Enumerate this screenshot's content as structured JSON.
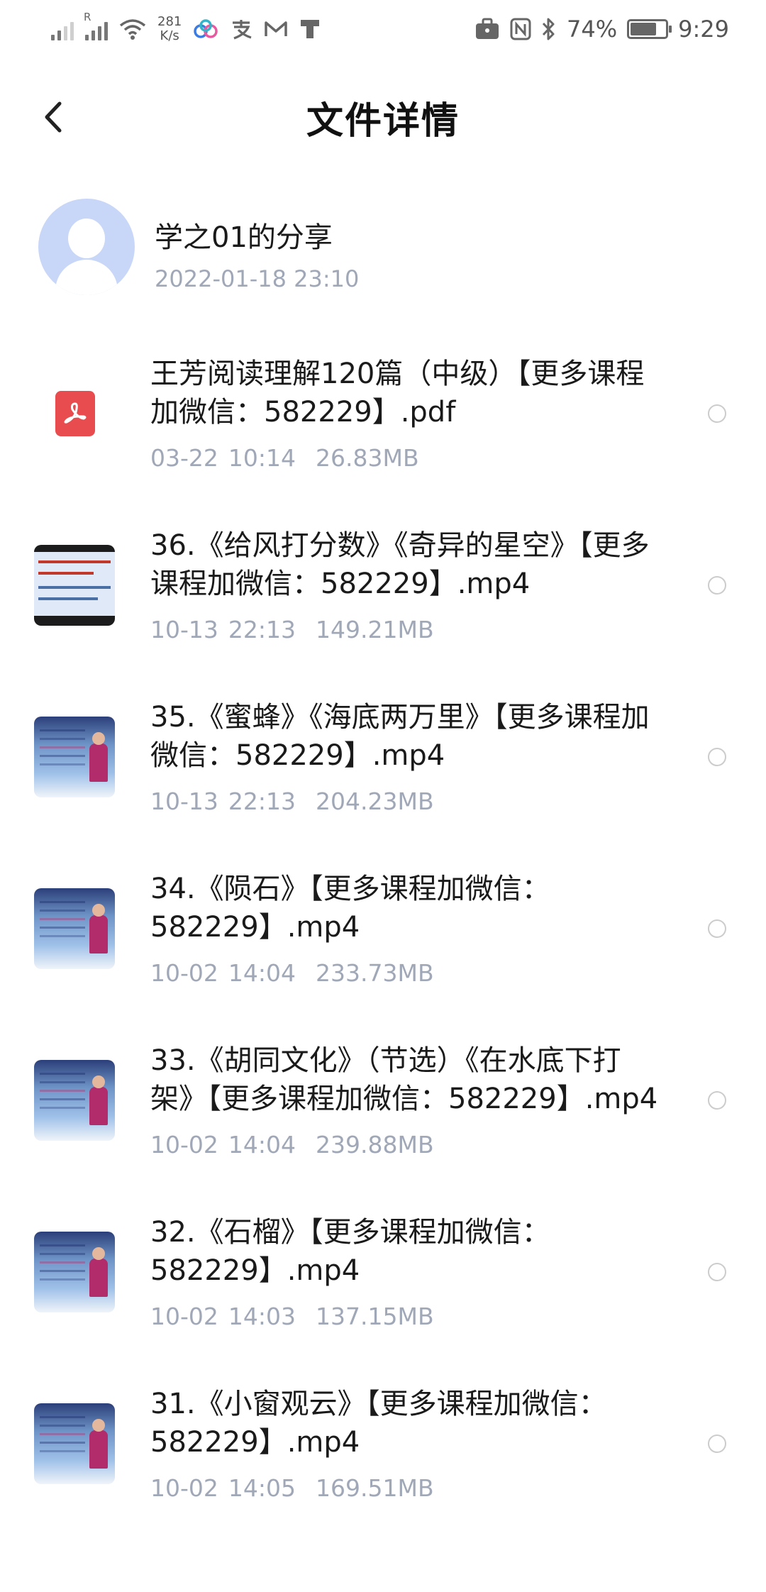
{
  "status_bar": {
    "network_speed_value": "281",
    "network_speed_unit": "K/s",
    "roaming_mark": "R",
    "app_icons": [
      "cloud-sync-icon",
      "alipay-icon",
      "mail-icon",
      "t-app-icon"
    ],
    "battery_percent": "74%",
    "battery_level": 0.74,
    "time": "9:29"
  },
  "header": {
    "title": "文件详情"
  },
  "sharer": {
    "name": "学之01的分享",
    "datetime": "2022-01-18  23:10"
  },
  "files": [
    {
      "name": "王芳阅读理解120篇（中级）【更多课程加微信：582229】.pdf",
      "date": "03-22",
      "time": "10:14",
      "size": "26.83MB",
      "type": "pdf"
    },
    {
      "name": "36.《给风打分数》《奇异的星空》【更多课程加微信：582229】.mp4",
      "date": "10-13",
      "time": "22:13",
      "size": "149.21MB",
      "type": "slide"
    },
    {
      "name": "35.《蜜蜂》《海底两万里》【更多课程加微信：582229】.mp4",
      "date": "10-13",
      "time": "22:13",
      "size": "204.23MB",
      "type": "video"
    },
    {
      "name": "34.《陨石》【更多课程加微信：582229】.mp4",
      "date": "10-02",
      "time": "14:04",
      "size": "233.73MB",
      "type": "video"
    },
    {
      "name": "33.《胡同文化》（节选）《在水底下打架》【更多课程加微信：582229】.mp4",
      "date": "10-02",
      "time": "14:04",
      "size": "239.88MB",
      "type": "video"
    },
    {
      "name": "32.《石榴》【更多课程加微信：582229】.mp4",
      "date": "10-02",
      "time": "14:03",
      "size": "137.15MB",
      "type": "video"
    },
    {
      "name": "31.《小窗观云》【更多课程加微信：582229】.mp4",
      "date": "10-02",
      "time": "14:05",
      "size": "169.51MB",
      "type": "video"
    }
  ]
}
